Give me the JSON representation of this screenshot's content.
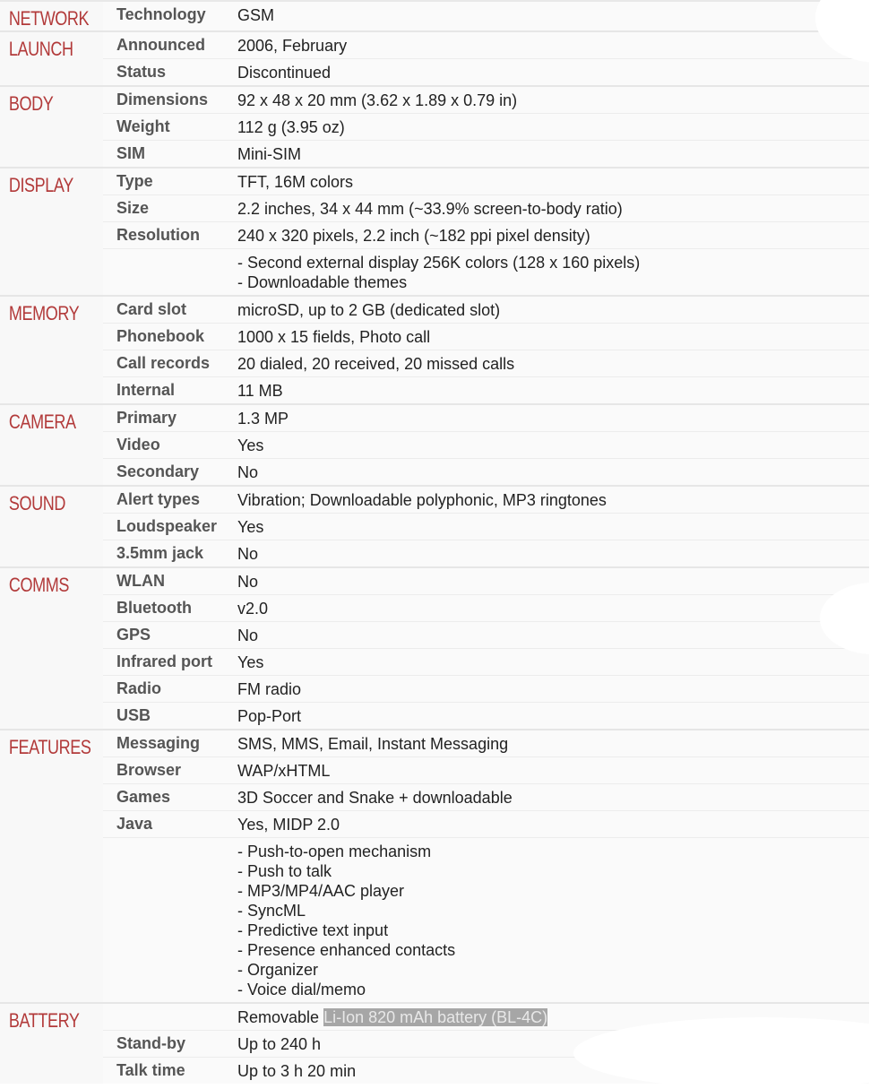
{
  "sections": [
    {
      "title": "NETWORK",
      "rows": [
        {
          "label": "Technology",
          "value": "GSM"
        }
      ]
    },
    {
      "title": "LAUNCH",
      "rows": [
        {
          "label": "Announced",
          "value": "2006, February"
        },
        {
          "label": "Status",
          "value": "Discontinued"
        }
      ]
    },
    {
      "title": "BODY",
      "rows": [
        {
          "label": "Dimensions",
          "value": "92 x 48 x 20 mm (3.62 x 1.89 x 0.79 in)"
        },
        {
          "label": "Weight",
          "value": "112 g (3.95 oz)"
        },
        {
          "label": "SIM",
          "value": "Mini-SIM"
        }
      ]
    },
    {
      "title": "DISPLAY",
      "rows": [
        {
          "label": "Type",
          "value": "TFT, 16M colors"
        },
        {
          "label": "Size",
          "value": "2.2 inches, 34 x 44 mm (~33.9% screen-to-body ratio)"
        },
        {
          "label": "Resolution",
          "value": "240 x 320 pixels, 2.2 inch (~182 ppi pixel density)"
        },
        {
          "label": "",
          "lines": [
            "- Second external display 256K colors (128 x 160 pixels)",
            "- Downloadable themes"
          ]
        }
      ]
    },
    {
      "title": "MEMORY",
      "rows": [
        {
          "label": "Card slot",
          "value": "microSD, up to 2 GB (dedicated slot)"
        },
        {
          "label": "Phonebook",
          "value": "1000 x 15 fields, Photo call"
        },
        {
          "label": "Call records",
          "value": "20 dialed, 20 received, 20 missed calls"
        },
        {
          "label": "Internal",
          "value": "11 MB"
        }
      ]
    },
    {
      "title": "CAMERA",
      "rows": [
        {
          "label": "Primary",
          "value": "1.3 MP"
        },
        {
          "label": "Video",
          "value": "Yes"
        },
        {
          "label": "Secondary",
          "value": "No"
        }
      ]
    },
    {
      "title": "SOUND",
      "rows": [
        {
          "label": "Alert types",
          "value": "Vibration; Downloadable polyphonic, MP3 ringtones"
        },
        {
          "label": "Loudspeaker",
          "value": "Yes"
        },
        {
          "label": "3.5mm jack",
          "value": "No"
        }
      ]
    },
    {
      "title": "COMMS",
      "rows": [
        {
          "label": "WLAN",
          "value": "No"
        },
        {
          "label": "Bluetooth",
          "value": "v2.0"
        },
        {
          "label": "GPS",
          "value": "No"
        },
        {
          "label": "Infrared port",
          "value": "Yes"
        },
        {
          "label": "Radio",
          "value": "FM radio"
        },
        {
          "label": "USB",
          "value": "Pop-Port"
        }
      ]
    },
    {
      "title": "FEATURES",
      "rows": [
        {
          "label": "Messaging",
          "value": "SMS, MMS, Email, Instant Messaging"
        },
        {
          "label": "Browser",
          "value": "WAP/xHTML"
        },
        {
          "label": "Games",
          "value": "3D Soccer and Snake + downloadable"
        },
        {
          "label": "Java",
          "value": "Yes, MIDP 2.0"
        },
        {
          "label": "",
          "lines": [
            "- Push-to-open mechanism",
            "- Push to talk",
            "- MP3/MP4/AAC player",
            "- SyncML",
            "- Predictive text input",
            "- Presence enhanced contacts",
            "- Organizer",
            "- Voice dial/memo"
          ]
        }
      ]
    },
    {
      "title": "BATTERY",
      "rows": [
        {
          "label": "",
          "value": "Removable",
          "highlight": "Li-Ion 820 mAh battery (BL-4C)"
        },
        {
          "label": "Stand-by",
          "value": "Up to 240 h"
        },
        {
          "label": "Talk time",
          "value": "Up to 3 h 20 min"
        }
      ]
    }
  ],
  "colors": {
    "section_title": "#b23a3a",
    "label": "#555555",
    "value": "#222222",
    "highlight_bg": "#a6a6a6"
  }
}
